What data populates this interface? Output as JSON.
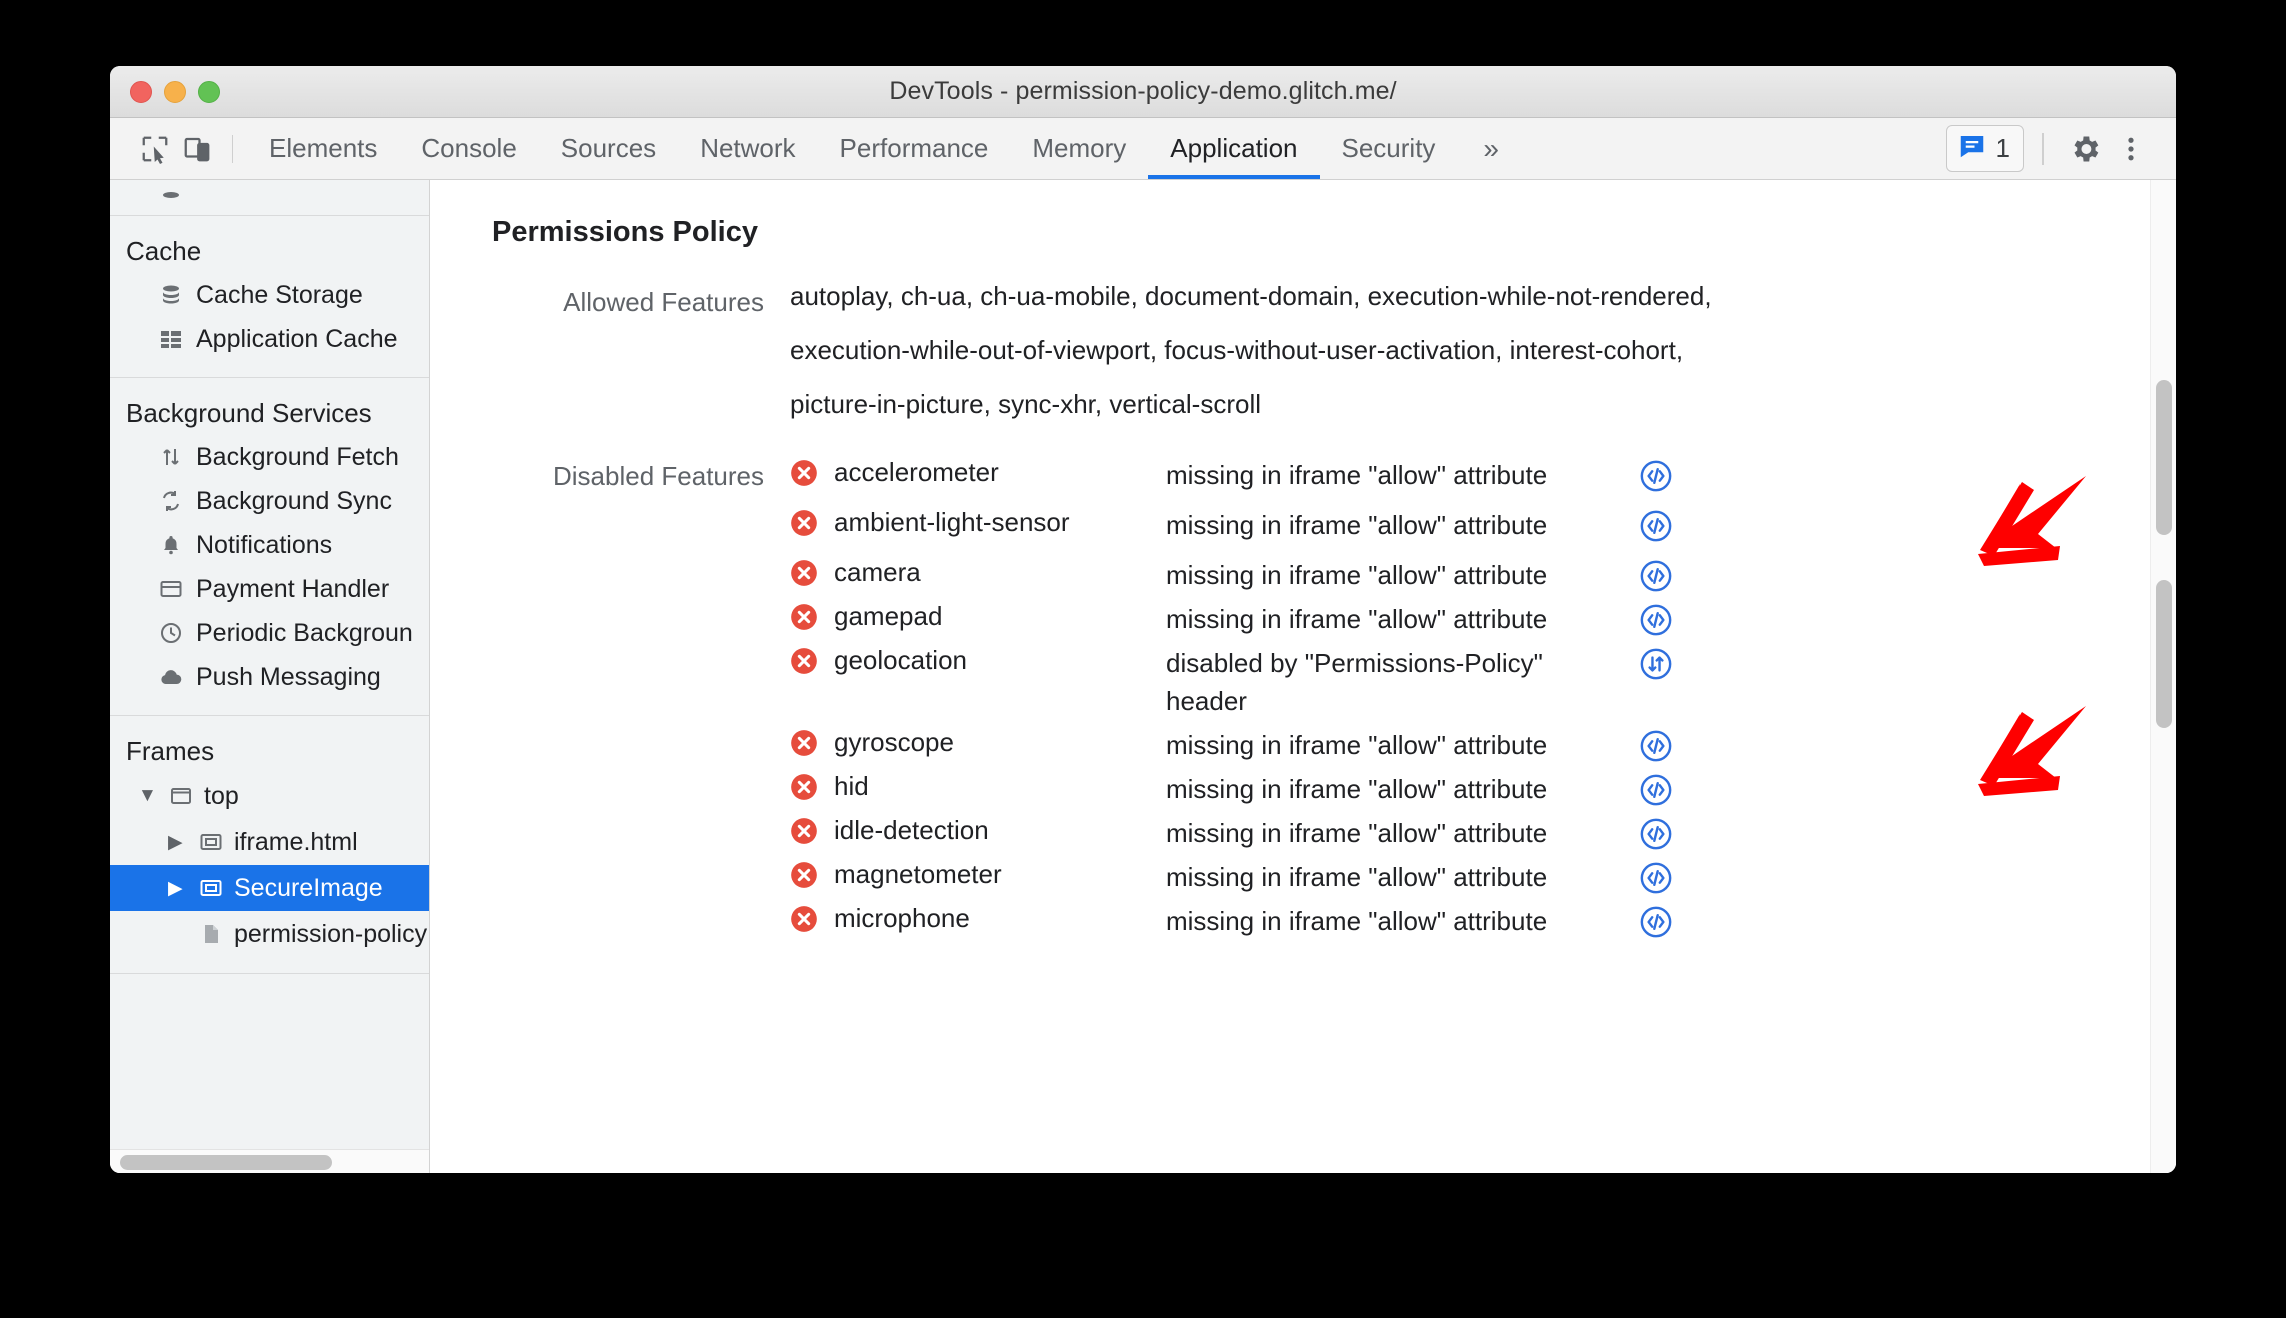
{
  "window": {
    "title": "DevTools - permission-policy-demo.glitch.me/",
    "traffic_lights": [
      "close",
      "minimize",
      "zoom"
    ]
  },
  "toolbar": {
    "inspect_icon": "inspect-element-icon",
    "device_icon": "device-toolbar-icon",
    "tabs": [
      {
        "label": "Elements",
        "active": false
      },
      {
        "label": "Console",
        "active": false
      },
      {
        "label": "Sources",
        "active": false
      },
      {
        "label": "Network",
        "active": false
      },
      {
        "label": "Performance",
        "active": false
      },
      {
        "label": "Memory",
        "active": false
      },
      {
        "label": "Application",
        "active": true
      },
      {
        "label": "Security",
        "active": false
      }
    ],
    "overflow_label": "»",
    "message_count": "1",
    "message_icon": "message-bubble-icon",
    "settings_icon": "gear-icon",
    "more_icon": "kebab-menu-icon",
    "accent_color": "#1a73e8"
  },
  "sidebar": {
    "sections": [
      {
        "title": "Cache",
        "items": [
          {
            "label": "Cache Storage",
            "icon": "database-icon"
          },
          {
            "label": "Application Cache",
            "icon": "grid-icon"
          }
        ]
      },
      {
        "title": "Background Services",
        "items": [
          {
            "label": "Background Fetch",
            "icon": "updown-arrows-icon"
          },
          {
            "label": "Background Sync",
            "icon": "sync-icon"
          },
          {
            "label": "Notifications",
            "icon": "bell-icon"
          },
          {
            "label": "Payment Handler",
            "icon": "credit-card-icon"
          },
          {
            "label": "Periodic Backgroun",
            "icon": "clock-icon"
          },
          {
            "label": "Push Messaging",
            "icon": "cloud-icon"
          }
        ]
      }
    ],
    "frames": {
      "title": "Frames",
      "tree": [
        {
          "label": "top",
          "level": 1,
          "arrow": "▼",
          "icon": "frame-icon",
          "selected": false
        },
        {
          "label": "iframe.html",
          "level": 2,
          "arrow": "▶",
          "icon": "iframe-icon",
          "selected": false
        },
        {
          "label": "SecureImage",
          "level": 2,
          "arrow": "▶",
          "icon": "iframe-icon",
          "selected": true
        },
        {
          "label": "permission-policy",
          "level": 3,
          "arrow": "",
          "icon": "document-icon",
          "selected": false
        }
      ]
    },
    "selection_color": "#1a73e8"
  },
  "main": {
    "panel_title": "Permissions Policy",
    "allowed_label": "Allowed Features",
    "allowed_lines": [
      "autoplay, ch-ua, ch-ua-mobile, document-domain, execution-while-not-rendered,",
      "execution-while-out-of-viewport, focus-without-user-activation, interest-cohort,",
      "picture-in-picture, sync-xhr, vertical-scroll"
    ],
    "disabled_label": "Disabled Features",
    "disabled_features": [
      {
        "name": "accelerometer",
        "reason": "missing in iframe \"allow\" attribute",
        "action_icon": "code-icon"
      },
      {
        "name": "ambient-light-sensor",
        "reason": "missing in iframe \"allow\" attribute",
        "action_icon": "code-icon"
      },
      {
        "name": "camera",
        "reason": "missing in iframe \"allow\" attribute",
        "action_icon": "code-icon"
      },
      {
        "name": "gamepad",
        "reason": "missing in iframe \"allow\" attribute",
        "action_icon": "code-icon"
      },
      {
        "name": "geolocation",
        "reason": "disabled by \"Permissions-Policy\" header",
        "action_icon": "network-request-icon"
      },
      {
        "name": "gyroscope",
        "reason": "missing in iframe \"allow\" attribute",
        "action_icon": "code-icon"
      },
      {
        "name": "hid",
        "reason": "missing in iframe \"allow\" attribute",
        "action_icon": "code-icon"
      },
      {
        "name": "idle-detection",
        "reason": "missing in iframe \"allow\" attribute",
        "action_icon": "code-icon"
      },
      {
        "name": "magnetometer",
        "reason": "missing in iframe \"allow\" attribute",
        "action_icon": "code-icon"
      },
      {
        "name": "microphone",
        "reason": "missing in iframe \"allow\" attribute",
        "action_icon": "code-icon"
      }
    ],
    "error_icon": "error-circle-x-icon",
    "error_color": "#e64c3c",
    "action_color": "#2f6fdd"
  },
  "annotations": {
    "arrows": [
      "callout-arrow-top",
      "callout-arrow-bottom"
    ],
    "color": "#fe0000"
  }
}
